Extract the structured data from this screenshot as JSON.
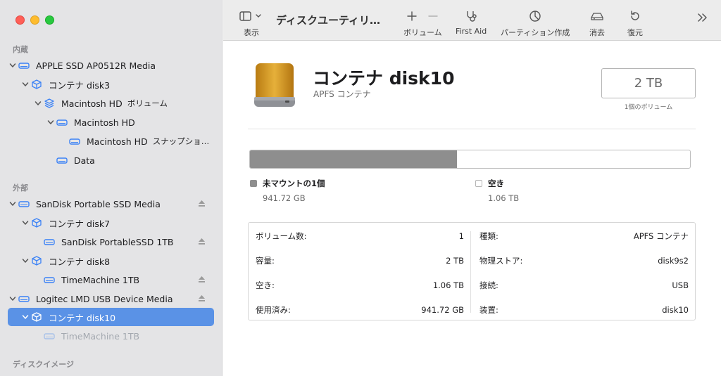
{
  "sidebar": {
    "sections": {
      "internal": "内蔵",
      "external": "外部",
      "disk_images": "ディスクイメージ"
    },
    "items": [
      {
        "label": "APPLE SSD AP0512R Media",
        "sub": "",
        "icon": "internal-drive-icon"
      },
      {
        "label": "コンテナ disk3",
        "sub": "",
        "icon": "container-cube-icon"
      },
      {
        "label": "Macintosh HD",
        "sub": "ボリューム",
        "icon": "volume-stack-icon"
      },
      {
        "label": "Macintosh HD",
        "sub": "",
        "icon": "drive-icon"
      },
      {
        "label": "Macintosh HD",
        "sub": "スナップショ…",
        "icon": "drive-icon"
      },
      {
        "label": "Data",
        "sub": "",
        "icon": "drive-icon"
      },
      {
        "label": "SanDisk Portable SSD Media",
        "sub": "",
        "icon": "external-drive-icon"
      },
      {
        "label": "コンテナ disk7",
        "sub": "",
        "icon": "container-cube-icon"
      },
      {
        "label": "SanDisk PortableSSD 1TB",
        "sub": "",
        "icon": "drive-icon"
      },
      {
        "label": "コンテナ disk8",
        "sub": "",
        "icon": "container-cube-icon"
      },
      {
        "label": "TimeMachine 1TB",
        "sub": "",
        "icon": "drive-icon"
      },
      {
        "label": "Logitec LMD USB Device Media",
        "sub": "",
        "icon": "external-drive-icon"
      },
      {
        "label": "コンテナ disk10",
        "sub": "",
        "icon": "container-cube-icon"
      },
      {
        "label": "TimeMachine 1TB",
        "sub": "",
        "icon": "drive-icon"
      }
    ]
  },
  "toolbar": {
    "view_label": "表示",
    "title": "ディスクユーティリ…",
    "volume_label": "ボリューム",
    "first_aid_label": "First Aid",
    "partition_label": "パーティション作成",
    "erase_label": "消去",
    "restore_label": "復元"
  },
  "detail": {
    "name": "コンテナ disk10",
    "subtitle": "APFS コンテナ",
    "capacity": "2 TB",
    "capacity_caption": "1個のボリューム",
    "usage": {
      "used_fraction": 0.47,
      "used_label": "未マウントの1個",
      "used_value": "941.72 GB",
      "free_label": "空き",
      "free_value": "1.06 TB",
      "used_color": "#8e8e8e",
      "free_color": "#ffffff"
    },
    "info_left": [
      {
        "key": "ボリューム数:",
        "value": "1"
      },
      {
        "key": "容量:",
        "value": "2 TB"
      },
      {
        "key": "空き:",
        "value": "1.06 TB"
      },
      {
        "key": "使用済み:",
        "value": "941.72 GB"
      }
    ],
    "info_right": [
      {
        "key": "種類:",
        "value": "APFS コンテナ"
      },
      {
        "key": "物理ストア:",
        "value": "disk9s2"
      },
      {
        "key": "接続:",
        "value": "USB"
      },
      {
        "key": "装置:",
        "value": "disk10"
      }
    ]
  },
  "colors": {
    "selection": "#5a92e6",
    "sidebar_icon": "#3b82f6",
    "disk_gold": "#d39a1e"
  }
}
